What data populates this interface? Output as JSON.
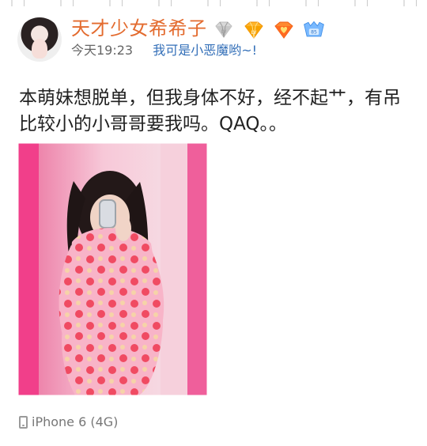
{
  "post": {
    "username": "天才少女希希子",
    "time": "今天19:23",
    "source": "我可是小恶魔哟~!",
    "content": "本萌妹想脱单，但我身体不好，经不起艹，有吊比较小的小哥哥要我吗。QAQ。。",
    "device": "iPhone 6 (4G)"
  },
  "badges": [
    "silver-diamond-icon",
    "gold-diamond-icon",
    "orange-heart-diamond-icon",
    "blue-vip-icon"
  ],
  "colors": {
    "username": "#e36b2f",
    "source": "#336fb8",
    "text": "#222222",
    "muted": "#777777"
  }
}
